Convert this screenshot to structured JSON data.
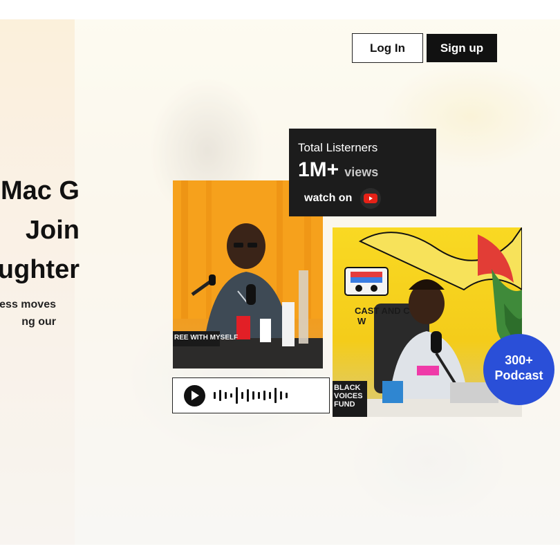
{
  "header": {
    "login_label": "Log In",
    "signup_label": "Sign up"
  },
  "hero": {
    "lines": [
      "Mac G",
      "Join",
      "ughter"
    ],
    "subtitle_lines": [
      "ess moves",
      "ng our"
    ]
  },
  "stats_card": {
    "title": "Total Listerners",
    "number": "1M+",
    "unit": "views",
    "watch_label": "watch on",
    "platform_icon": "youtube-icon"
  },
  "photo1": {
    "sign_text": "REE WITH MYSELF"
  },
  "photo2": {
    "poster_text": "CAST AND C",
    "poster_text_2": "W",
    "book_text": [
      "BLACK",
      "VOICES",
      "FUND"
    ]
  },
  "player": {
    "icon": "play-icon"
  },
  "badge": {
    "count": "300+",
    "label": "Podcast"
  },
  "colors": {
    "badge_blue": "#2a4fd8",
    "dark": "#1c1c1c",
    "youtube_red": "#e62117"
  }
}
